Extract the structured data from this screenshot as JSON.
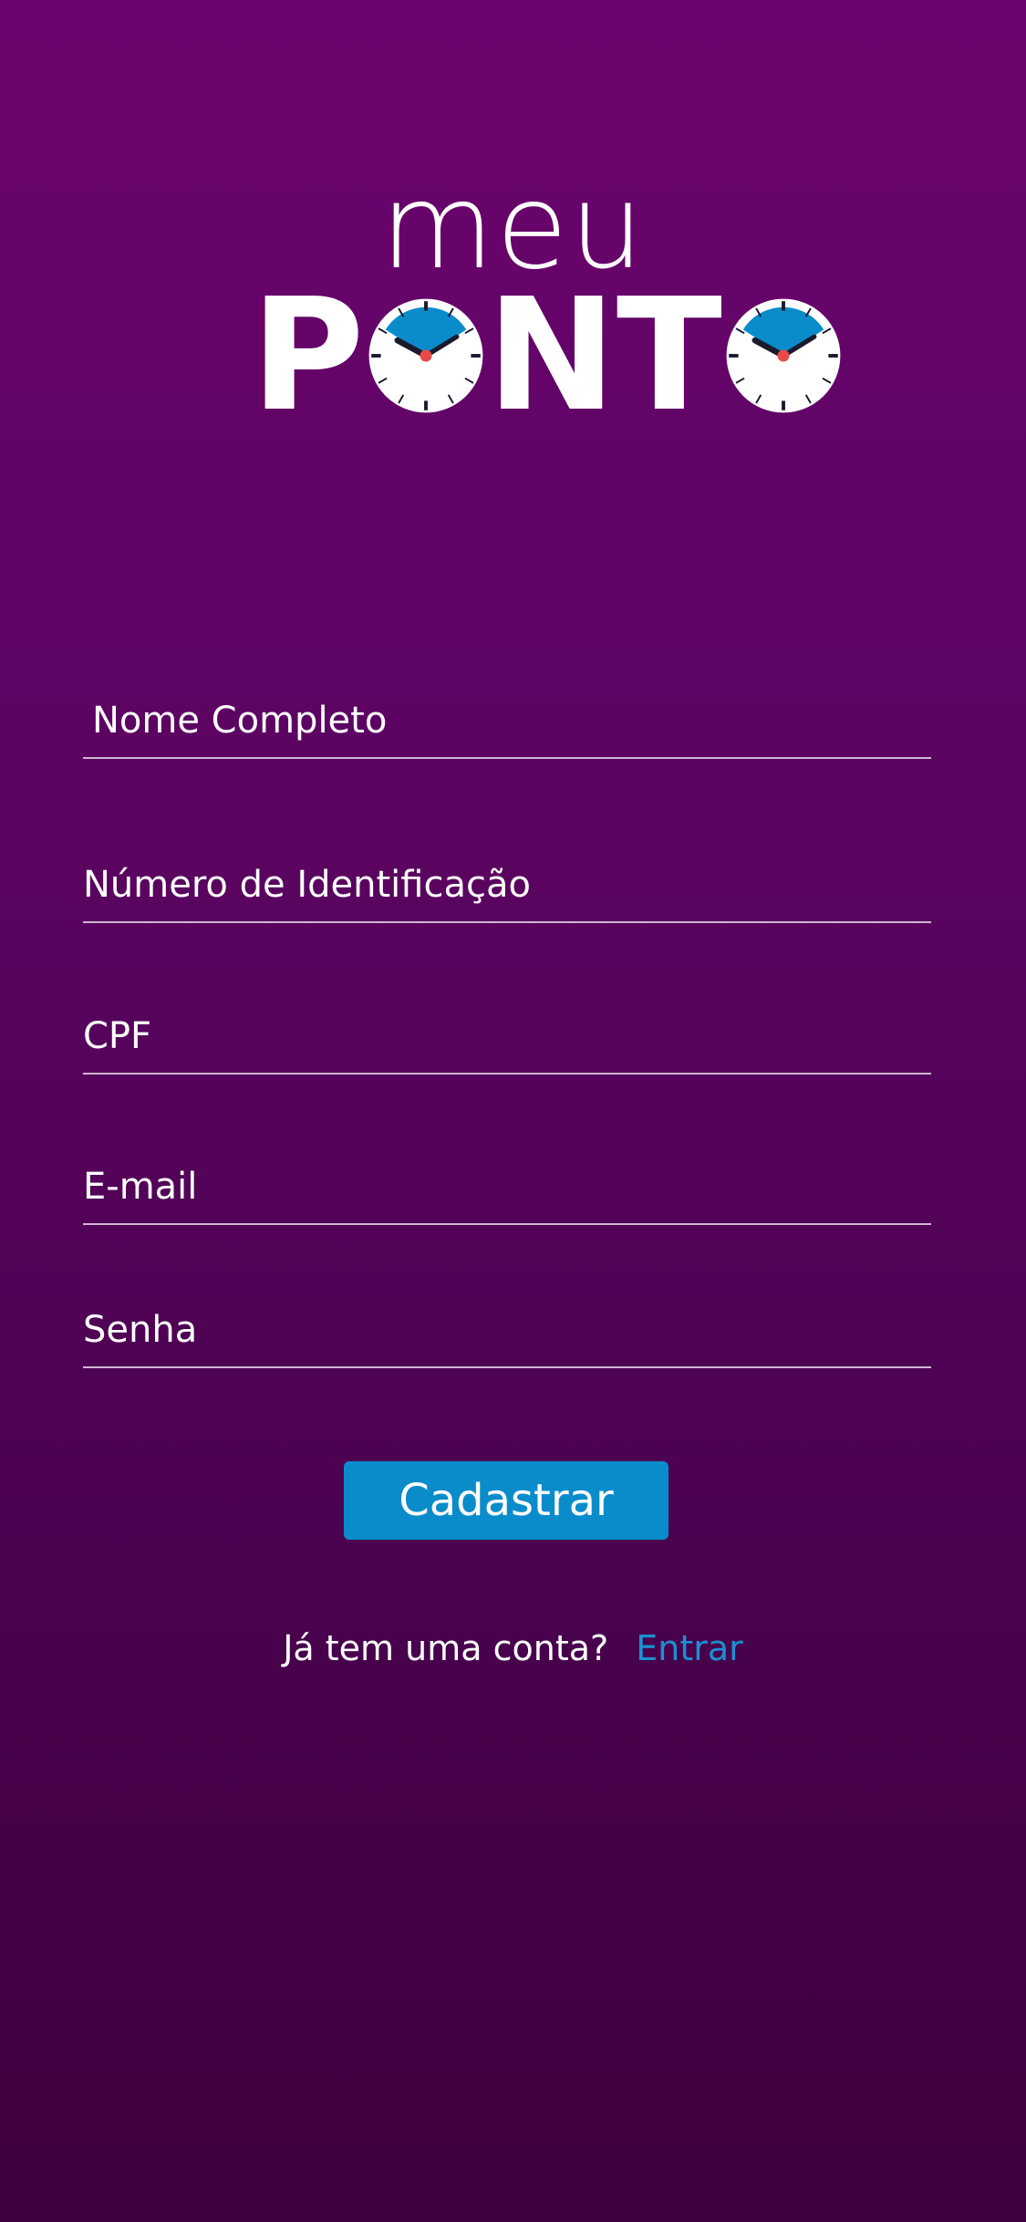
{
  "logo": {
    "line1": "meu",
    "letters": [
      "P",
      "N",
      "T"
    ]
  },
  "form": {
    "name_placeholder": "Nome Completo",
    "id_placeholder": "Número de Identificação",
    "cpf_placeholder": "CPF",
    "email_placeholder": "E-mail",
    "password_placeholder": "Senha"
  },
  "actions": {
    "submit_label": "Cadastrar",
    "signin_prompt": "Já tem uma conta?",
    "signin_link": "Entrar"
  },
  "colors": {
    "accent": "#0a8ccb",
    "link": "#1c8fcf",
    "background_top": "#6b046e",
    "background_bottom": "#3e003f"
  },
  "icons": {
    "clock": "clock-icon"
  }
}
